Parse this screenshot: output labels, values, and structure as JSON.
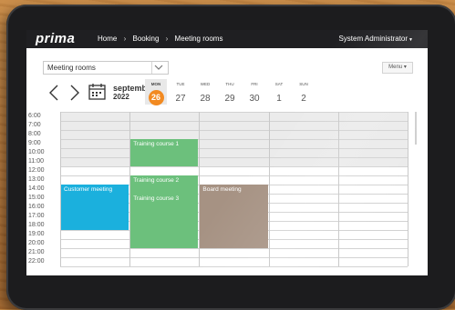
{
  "app": {
    "logo": "prima"
  },
  "breadcrumb": [
    "Home",
    "Booking",
    "Meeting rooms"
  ],
  "user": {
    "name": "System Administrator"
  },
  "toolbar": {
    "select_value": "Meeting rooms",
    "menu_label": "Menu",
    "month": "september",
    "year": "2022"
  },
  "days": [
    {
      "name": "MON",
      "date": "26",
      "today": true
    },
    {
      "name": "TUE",
      "date": "27"
    },
    {
      "name": "WED",
      "date": "28"
    },
    {
      "name": "THU",
      "date": "29"
    },
    {
      "name": "FRI",
      "date": "30"
    },
    {
      "name": "SAT",
      "date": "1"
    },
    {
      "name": "SUN",
      "date": "2"
    }
  ],
  "times": [
    "6:00",
    "7:00",
    "8:00",
    "9:00",
    "10:00",
    "11:00",
    "12:00",
    "13:00",
    "14:00",
    "15:00",
    "16:00",
    "17:00",
    "18:00",
    "19:00",
    "20:00",
    "21:00",
    "22:00"
  ],
  "events": [
    {
      "title": "Training course 1",
      "start": "9:00",
      "end": "12:00",
      "color": "#6cc07c"
    },
    {
      "title": "Training course 2",
      "start": "13:00",
      "end": "15:00",
      "color": "#6cc07c"
    },
    {
      "title": "Training course 3",
      "start": "15:00",
      "end": "21:00",
      "color": "#6cc07c"
    },
    {
      "title": "Customer meeting",
      "start": "14:00",
      "end": "19:00",
      "color": "#1bb0dd"
    },
    {
      "title": "Board meeting",
      "start": "14:00",
      "end": "21:00",
      "color": "#a69283"
    }
  ],
  "colors": {
    "topbar": "#1f1f22",
    "today_badge": "#f28a21",
    "event_green": "#6cc07c",
    "event_blue": "#1bb0dd",
    "event_taupe": "#a69283"
  }
}
